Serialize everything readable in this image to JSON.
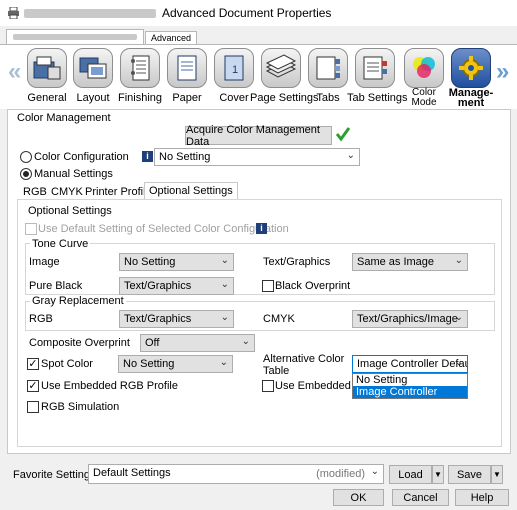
{
  "window": {
    "title": "Advanced Document Properties"
  },
  "tabs": {
    "advanced": "Advanced"
  },
  "toolbar": {
    "items": [
      {
        "label": "General",
        "icon": "general-icon"
      },
      {
        "label": "Layout",
        "icon": "layout-icon"
      },
      {
        "label": "Finishing",
        "icon": "finishing-icon"
      },
      {
        "label": "Paper",
        "icon": "paper-icon"
      },
      {
        "label": "Cover",
        "icon": "cover-icon"
      },
      {
        "label": "Page Settings",
        "icon": "page-settings-icon"
      },
      {
        "label": "Tabs",
        "icon": "tabs-icon"
      },
      {
        "label": "Tab Settings",
        "icon": "tab-settings-icon"
      },
      {
        "label_line1": "Color",
        "label_line2": "Mode",
        "icon": "color-mode-icon"
      },
      {
        "label_line1": "Manage-",
        "label_line2": "ment",
        "icon": "management-icon"
      }
    ],
    "cover_glyph": "1"
  },
  "color_management": {
    "group_title": "Color Management",
    "acquire_button": "Acquire Color Management Data",
    "color_config_label": "Color Configuration",
    "color_config_value": "No Setting",
    "manual_settings_label": "Manual Settings",
    "tabs": [
      "RGB",
      "CMYK",
      "Printer Profile",
      "Optional Settings"
    ]
  },
  "optional": {
    "group_title": "Optional Settings",
    "use_default_label": "Use Default Setting of Selected Color Configuration",
    "tone_curve_title": "Tone Curve",
    "image_label": "Image",
    "image_value": "No Setting",
    "text_graphics_label": "Text/Graphics",
    "text_graphics_value": "Same as Image",
    "pure_black_label": "Pure Black",
    "pure_black_value": "Text/Graphics",
    "black_overprint_label": "Black Overprint",
    "gray_replacement_title": "Gray Replacement",
    "rgb_label": "RGB",
    "rgb_value": "Text/Graphics",
    "cmyk_label": "CMYK",
    "cmyk_value": "Text/Graphics/Image",
    "composite_overprint_label": "Composite Overprint",
    "composite_overprint_value": "Off",
    "spot_color_label": "Spot Color",
    "spot_color_value": "No Setting",
    "alt_color_table_label_line1": "Alternative Color",
    "alt_color_table_label_line2": "Table",
    "alt_color_table_value": "Image Controller Defau",
    "alt_color_table_options": [
      "No Setting",
      "Image Controller Default"
    ],
    "use_embedded_rgb_label": "Use Embedded RGB Profile",
    "use_embedded_cm_label": "Use Embedded CM",
    "rgb_simulation_label": "RGB Simulation"
  },
  "footer": {
    "favorite_label": "Favorite Setting",
    "favorite_value": "Default Settings",
    "favorite_modified": "(modified)",
    "load_button": "Load",
    "save_button": "Save",
    "ok_button": "OK",
    "cancel_button": "Cancel",
    "help_button": "Help"
  },
  "colors": {
    "accent": "#0078d7",
    "checkmark": "#2e9e2e",
    "active_icon": "#1f4f9e"
  }
}
